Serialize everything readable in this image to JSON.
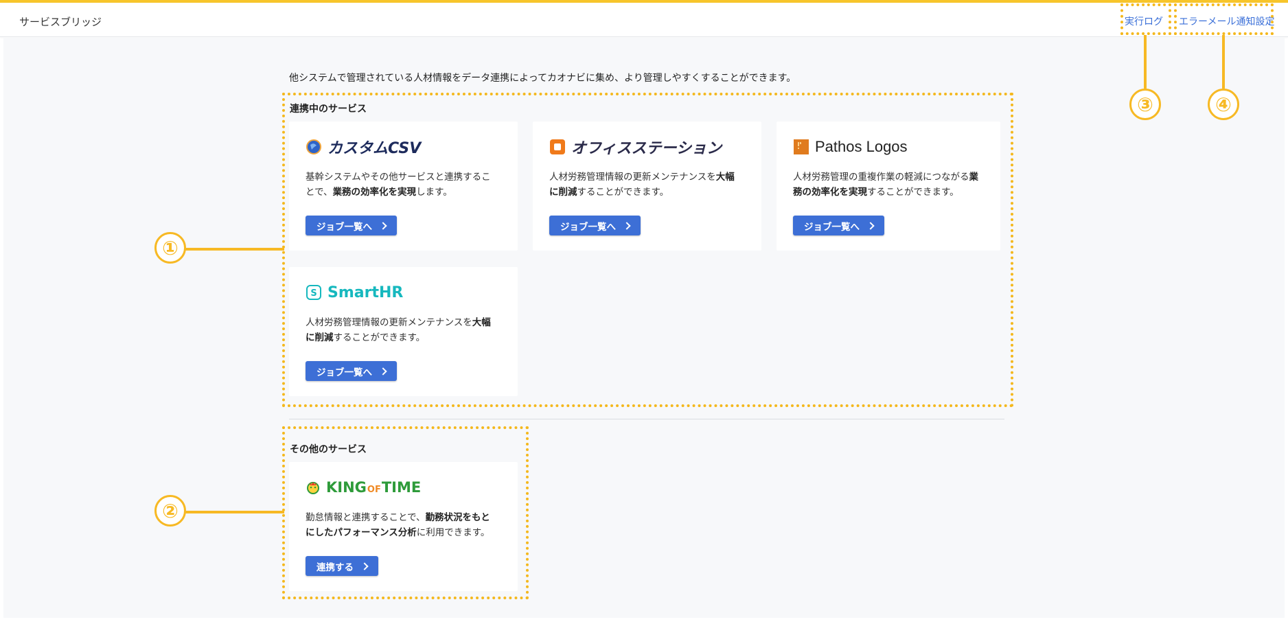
{
  "header": {
    "app_title": "サービスブリッジ",
    "exec_log": "実行ログ",
    "error_mail": "エラーメール通知設定"
  },
  "intro_text": "他システムで管理されている人材情報をデータ連携によってカオナビに集め、より管理しやすくすることができます。",
  "connected": {
    "title": "連携中のサービス",
    "cards": [
      {
        "logo": "カスタムCSV",
        "desc_plain_1": "基幹システムやその他サービスと連携するこ",
        "desc_plain_2": "とで、",
        "desc_bold": "業務の効率化を実現",
        "desc_plain_3": "します。",
        "button": "ジョブ一覧へ"
      },
      {
        "logo": "オフィスステーション",
        "desc_plain_1": "人材労務管理情報の更新メンテナンスを",
        "desc_bold_1": "大幅",
        "desc_bold_2": "に削減",
        "desc_plain_2": "することができます。",
        "button": "ジョブ一覧へ"
      },
      {
        "logo": "Pathos Logos",
        "desc_plain_1": "人材労務管理の重複作業の軽減につながる",
        "desc_bold_1": "業",
        "desc_bold_2": "務の効率化を実現",
        "desc_plain_2": "することができます。",
        "button": "ジョブ一覧へ"
      },
      {
        "logo": "SmartHR",
        "desc_plain_1": "人材労務管理情報の更新メンテナンスを",
        "desc_bold_1": "大幅",
        "desc_bold_2": "に削減",
        "desc_plain_2": "することができます。",
        "button": "ジョブ一覧へ"
      }
    ]
  },
  "other": {
    "title": "その他のサービス",
    "cards": [
      {
        "logo_king": "KING",
        "logo_of": "OF",
        "logo_time": "TIME",
        "desc_plain_1": "勤怠情報と連携することで、",
        "desc_bold_1": "勤務状況をもと",
        "desc_bold_2": "にしたパフォーマンス分析",
        "desc_plain_2": "に利用できます。",
        "button": "連携する"
      }
    ]
  },
  "callouts": [
    "①",
    "②",
    "③",
    "④"
  ],
  "colors": {
    "accent_yellow": "#f7b924",
    "button_blue": "#3d6fd6",
    "link_blue": "#3a6fd8"
  }
}
